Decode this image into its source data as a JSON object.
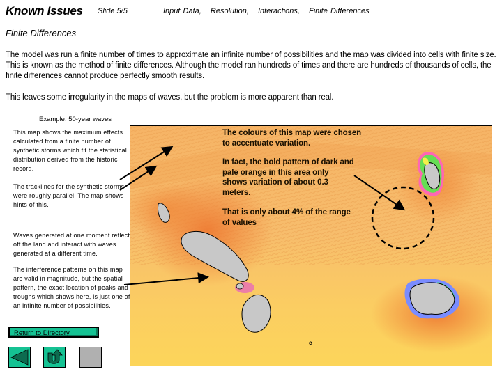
{
  "header": {
    "title": "Known Issues",
    "slide_number": "Slide 5/5",
    "topics": [
      "Input Data,",
      "Resolution,",
      "Interactions,",
      "Finite Differences"
    ]
  },
  "section_title": "Finite Differences",
  "paragraphs": [
    "The model was run a finite number of times to approximate an infinite number of possibilities and the map was divided into cells with finite size.  This is known as the method of finite differences.   Although the model ran hundreds of times and there are hundreds of thousands of cells, the finite differences cannot produce perfectly smooth results.",
    "This leaves some irregularity in the maps of waves, but the problem is more apparent than real."
  ],
  "example_label": "Example: 50-year waves",
  "side_notes": [
    "This map shows the maximum effects calculated from a finite number of synthetic storms which fit the statistical distribution derived from the historic record.",
    "The tracklines for the synthetic storms were roughly parallel. The map shows hints of this.",
    "Waves generated at one moment reflect off the land and interact with waves generated at a different time.",
    "The interference patterns on this map are valid in magnitude, but the spatial pattern, the exact location of peaks and troughs which shows here, is just one of an infinite number of possibilities."
  ],
  "map": {
    "notes": [
      "The colours of this map were chosen to accentuate variation.",
      "In fact, the bold pattern of dark and pale orange in this area only shows variation of about 0.3 meters.",
      "That is only about 4% of the range of values"
    ],
    "mark": "c",
    "colors": {
      "deep_orange": "#f08a3c",
      "mid_orange": "#f6b466",
      "pale_yellow": "#fcd55a",
      "land": "#c8c8c8"
    }
  },
  "navigation": {
    "return_label": "Return to Directory",
    "prev_icon": "triangle-left-icon",
    "back_icon": "u-turn-arrow-icon",
    "accent": "#15c293",
    "icon_dark": "#0d6b4f"
  }
}
